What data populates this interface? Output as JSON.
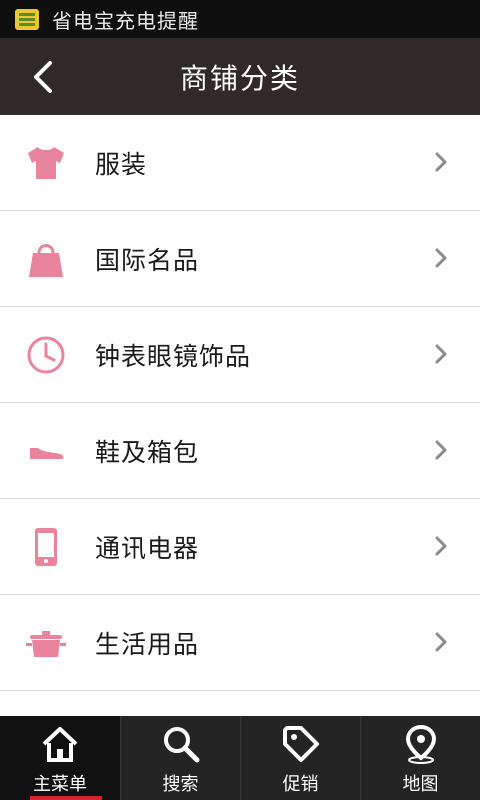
{
  "status": {
    "text": "省电宝充电提醒",
    "icon": "battery-saver-app-icon"
  },
  "header": {
    "title": "商铺分类",
    "back_icon": "chevron-left-icon"
  },
  "categories": [
    {
      "label": "服装",
      "icon": "tshirt-icon"
    },
    {
      "label": "国际名品",
      "icon": "handbag-icon"
    },
    {
      "label": "钟表眼镜饰品",
      "icon": "clock-icon"
    },
    {
      "label": "鞋及箱包",
      "icon": "shoe-icon"
    },
    {
      "label": "通讯电器",
      "icon": "mobile-phone-icon"
    },
    {
      "label": "生活用品",
      "icon": "cooking-pot-icon"
    }
  ],
  "tabs": [
    {
      "label": "主菜单",
      "icon": "home-icon",
      "active": true
    },
    {
      "label": "搜索",
      "icon": "search-icon",
      "active": false
    },
    {
      "label": "促销",
      "icon": "price-tag-icon",
      "active": false
    },
    {
      "label": "地图",
      "icon": "map-pin-icon",
      "active": false
    }
  ],
  "colors": {
    "accent_pink": "#e8849c",
    "header_bg": "#2f2a28",
    "tab_active": "#d9222a"
  }
}
